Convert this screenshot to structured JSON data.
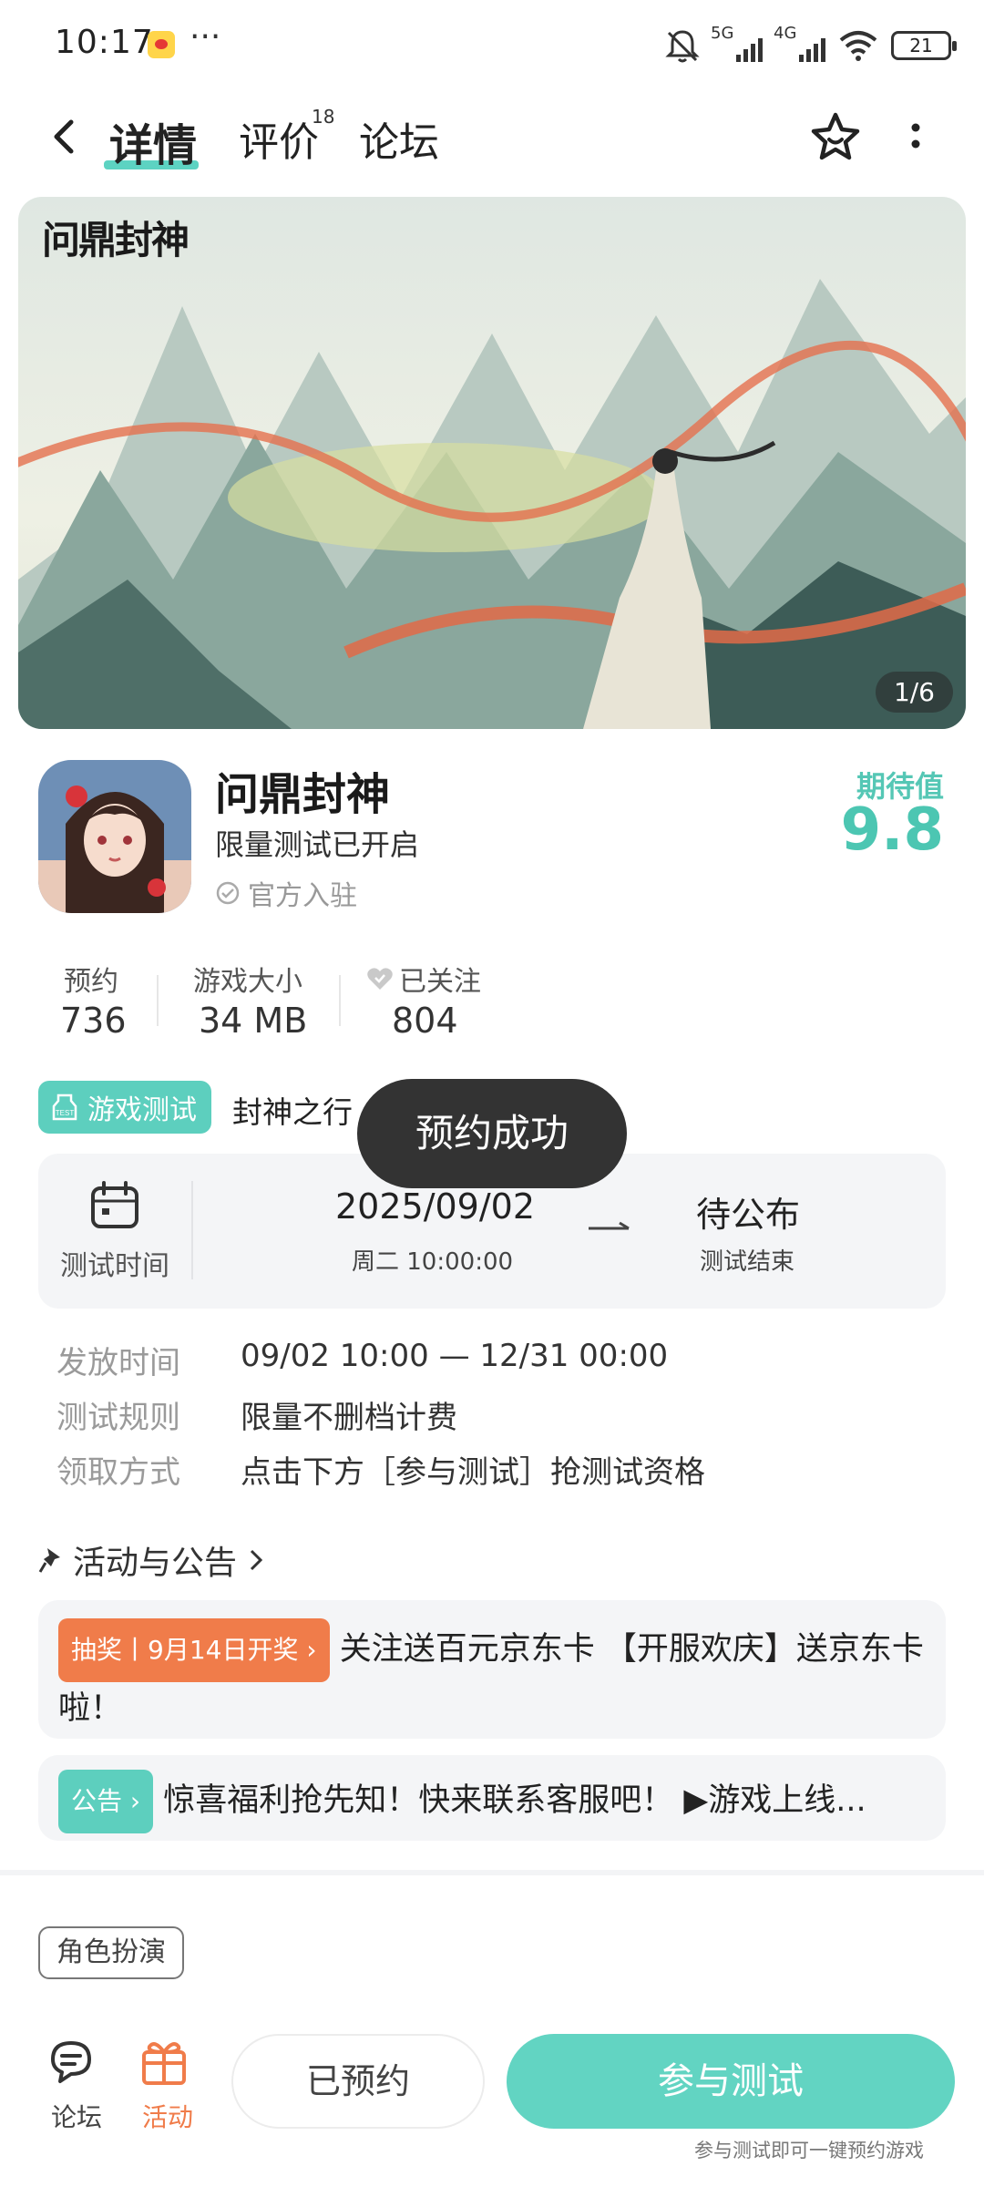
{
  "status_bar": {
    "time": "10:17",
    "dots": "···",
    "network_1": "5G",
    "network_2": "4G",
    "battery": "21"
  },
  "nav": {
    "tabs": [
      {
        "label": "详情"
      },
      {
        "label": "评价",
        "badge": "18"
      },
      {
        "label": "论坛"
      }
    ]
  },
  "banner": {
    "logo_text": "问鼎封神",
    "counter": "1/6"
  },
  "game": {
    "title": "问鼎封神",
    "subtitle": "限量测试已开启",
    "official": "官方入驻",
    "expect_label": "期待值",
    "expect_value": "9.8"
  },
  "stats": [
    {
      "label": "预约",
      "value": "736"
    },
    {
      "label": "游戏大小",
      "value": "34 MB"
    },
    {
      "label": "已关注",
      "value": "804"
    }
  ],
  "test": {
    "tag": "游戏测试",
    "name": "封神之行",
    "toast": "预约成功",
    "schedule_label": "测试时间",
    "start_date": "2025/09/02",
    "start_time": "周二  10:00:00",
    "end_value": "待公布",
    "end_label": "测试结束"
  },
  "info_rows": [
    {
      "label": "发放时间",
      "value": "09/02 10:00 — 12/31 00:00"
    },
    {
      "label": "测试规则",
      "value": "限量不删档计费"
    },
    {
      "label": "领取方式",
      "value": "点击下方［参与测试］抢测试资格"
    }
  ],
  "activity": {
    "header": "活动与公告",
    "items": [
      {
        "badge": "抽奖丨9月14日开奖 ›",
        "text": "关注送百元京东卡 【开服欢庆】送京东卡啦！"
      },
      {
        "badge": "公告 ›",
        "text": "惊喜福利抢先知！快来联系客服吧！ ▶游戏上线..."
      }
    ]
  },
  "genre_tag": "角色扮演",
  "bottom_bar": {
    "forum_label": "论坛",
    "activity_label": "活动",
    "reserved_button": "已预约",
    "join_button": "参与测试",
    "join_hint": "参与测试即可一键预约游戏"
  },
  "colors": {
    "accent_teal": "#5dcfbe",
    "accent_orange": "#f07c4a"
  }
}
